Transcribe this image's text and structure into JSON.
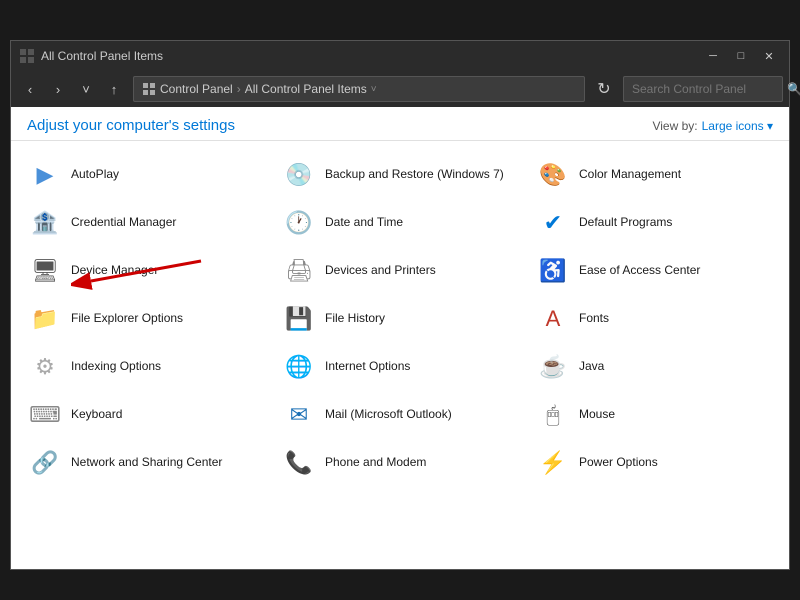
{
  "window": {
    "title": "All Control Panel Items",
    "titlebar_icon": "⊞",
    "minimize": "─",
    "maximize": "□",
    "close": "✕"
  },
  "navbar": {
    "back": "‹",
    "forward": "›",
    "down": "˅",
    "up": "↑",
    "address_parts": [
      "Control Panel",
      "All Control Panel Items"
    ],
    "refresh": "↻",
    "search_placeholder": "Search Control Panel",
    "search_icon": "🔍"
  },
  "header": {
    "title": "Adjust your computer's settings",
    "viewby_label": "View by:",
    "viewby_value": "Large icons ▾"
  },
  "items": [
    {
      "label": "AutoPlay",
      "icon": "▶",
      "color": "icon-autoplay"
    },
    {
      "label": "Backup and Restore (Windows 7)",
      "icon": "🖥",
      "color": "icon-backup"
    },
    {
      "label": "Color Management",
      "icon": "🎨",
      "color": "icon-color"
    },
    {
      "label": "Credential Manager",
      "icon": "🏦",
      "color": "icon-credential"
    },
    {
      "label": "Date and Time",
      "icon": "🕐",
      "color": "icon-datetime"
    },
    {
      "label": "Default Programs",
      "icon": "🔲",
      "color": "icon-default"
    },
    {
      "label": "Device Manager",
      "icon": "🖥",
      "color": "icon-device"
    },
    {
      "label": "Devices and Printers",
      "icon": "🖨",
      "color": "icon-devices"
    },
    {
      "label": "Ease of Access Center",
      "icon": "♿",
      "color": "icon-ease"
    },
    {
      "label": "File Explorer Options",
      "icon": "📁",
      "color": "icon-fileexp"
    },
    {
      "label": "File History",
      "icon": "💾",
      "color": "icon-history"
    },
    {
      "label": "Fonts",
      "icon": "A",
      "color": "icon-fonts"
    },
    {
      "label": "Indexing Options",
      "icon": "🔍",
      "color": "icon-indexing"
    },
    {
      "label": "Internet Options",
      "icon": "🌐",
      "color": "icon-internet"
    },
    {
      "label": "Java",
      "icon": "☕",
      "color": "icon-java"
    },
    {
      "label": "Keyboard",
      "icon": "⌨",
      "color": "icon-keyboard"
    },
    {
      "label": "Mail (Microsoft Outlook)",
      "icon": "📧",
      "color": "icon-mail"
    },
    {
      "label": "Mouse",
      "icon": "🖱",
      "color": "icon-mouse"
    },
    {
      "label": "Network and Sharing Center",
      "icon": "🔗",
      "color": "icon-network"
    },
    {
      "label": "Phone and Modem",
      "icon": "📠",
      "color": "icon-phone"
    },
    {
      "label": "Power Options",
      "icon": "⚡",
      "color": "icon-power"
    }
  ]
}
